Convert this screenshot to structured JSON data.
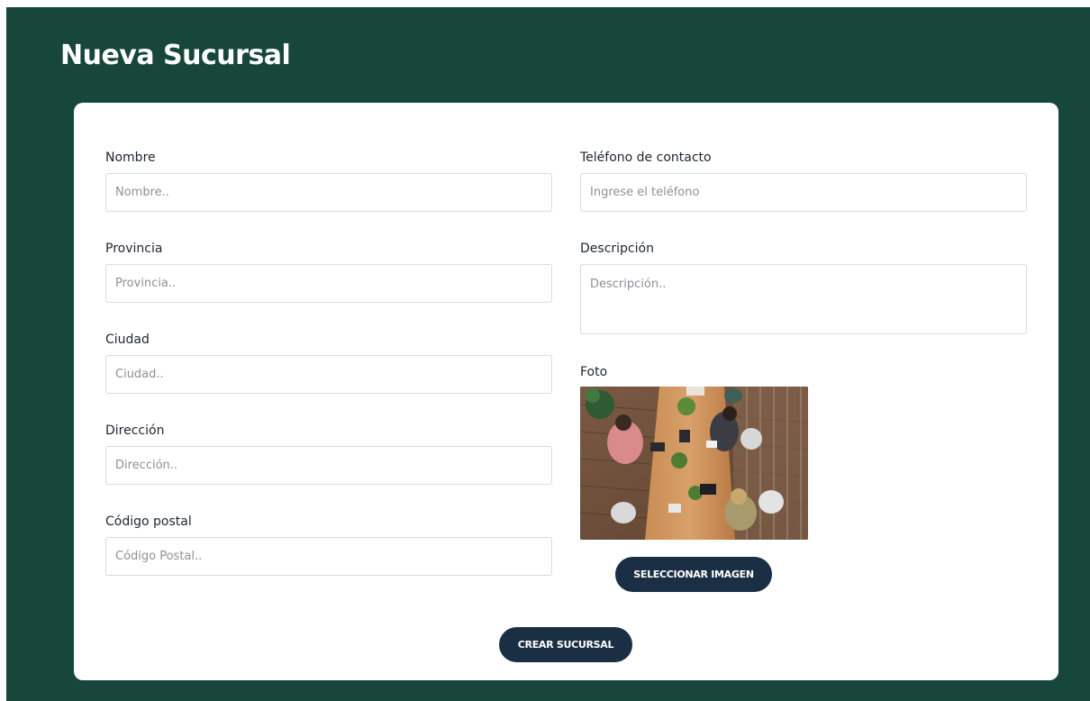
{
  "page": {
    "title": "Nueva Sucursal"
  },
  "form": {
    "left": [
      {
        "label": "Nombre",
        "placeholder": "Nombre.."
      },
      {
        "label": "Provincia",
        "placeholder": "Provincia.."
      },
      {
        "label": "Ciudad",
        "placeholder": "Ciudad.."
      },
      {
        "label": "Dirección",
        "placeholder": "Dirección.."
      },
      {
        "label": "Código postal",
        "placeholder": "Código Postal.."
      }
    ],
    "phone": {
      "label": "Teléfono de contacto",
      "placeholder": "Ingrese el teléfono"
    },
    "description": {
      "label": "Descripción",
      "placeholder": "Descripción.."
    },
    "photo": {
      "label": "Foto"
    },
    "select_image_button": "SELECCIONAR IMAGEN",
    "submit_button": "CREAR SUCURSAL"
  },
  "colors": {
    "background": "#17473a",
    "card": "#ffffff",
    "button": "#1b2f44"
  }
}
